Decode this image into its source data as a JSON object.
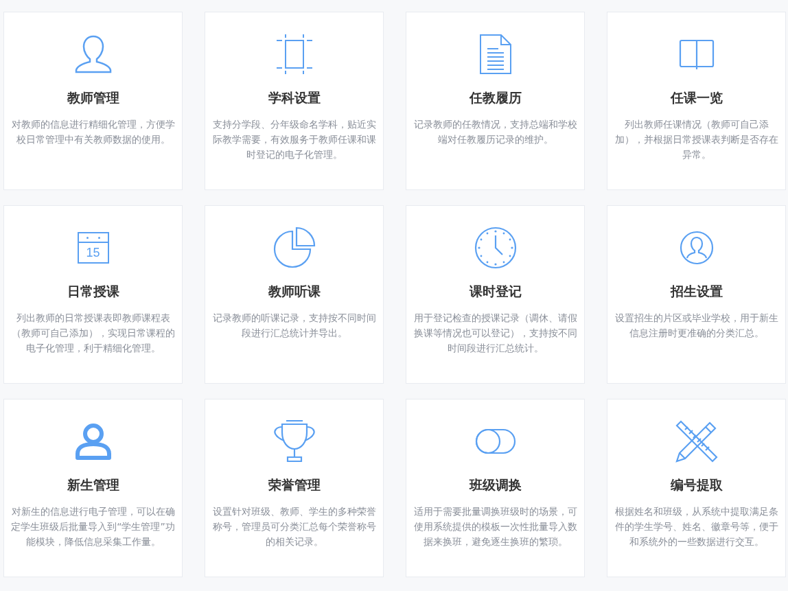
{
  "cards": [
    {
      "title": "教师管理",
      "description": "对教师的信息进行精细化管理，方便学校日常管理中有关教师数据的使用。"
    },
    {
      "title": "学科设置",
      "description": "支持分学段、分年级命名学科，贴近实际教学需要，有效服务于教师任课和课时登记的电子化管理。"
    },
    {
      "title": "任教履历",
      "description": "记录教师的任教情况，支持总端和学校端对任教履历记录的维护。"
    },
    {
      "title": "任课一览",
      "description": "列出教师任课情况（教师可自己添加），并根据日常授课表判断是否存在异常。"
    },
    {
      "icon_label": "15",
      "title": "日常授课",
      "description": "列出教师的日常授课表即教师课程表（教师可自己添加），实现日常课程的电子化管理，利于精细化管理。"
    },
    {
      "title": "教师听课",
      "description": "记录教师的听课记录，支持按不同时间段进行汇总统计并导出。"
    },
    {
      "title": "课时登记",
      "description": "用于登记检查的授课记录（调休、请假换课等情况也可以登记），支持按不同时间段进行汇总统计。"
    },
    {
      "title": "招生设置",
      "description": "设置招生的片区或毕业学校，用于新生信息注册时更准确的分类汇总。"
    },
    {
      "title": "新生管理",
      "description": "对新生的信息进行电子管理，可以在确定学生班级后批量导入到“学生管理”功能模块，降低信息采集工作量。"
    },
    {
      "title": "荣誉管理",
      "description": "设置针对班级、教师、学生的多种荣誉称号，管理员可分类汇总每个荣誉称号的相关记录。"
    },
    {
      "title": "班级调换",
      "description": "适用于需要批量调换班级时的场景，可使用系统提供的模板一次性批量导入数据来换班，避免逐生换班的繁琐。"
    },
    {
      "title": "编号提取",
      "description": "根据姓名和班级，从系统中提取满足条件的学生学号、姓名、徽章号等，便于和系统外的一些数据进行交互。"
    }
  ]
}
